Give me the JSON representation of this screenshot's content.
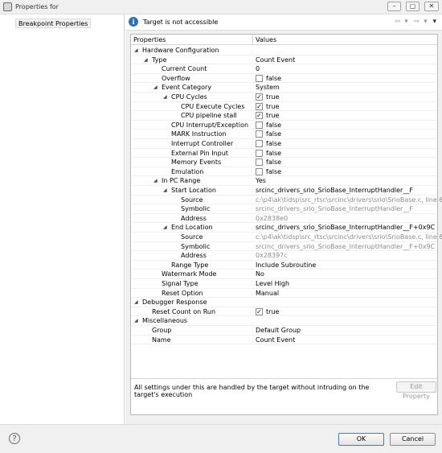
{
  "window": {
    "title": "Properties for",
    "minimize_glyph": "–",
    "maximize_glyph": "▢",
    "close_glyph": "✕"
  },
  "sidebar": {
    "items": [
      {
        "label": "Breakpoint Properties",
        "selected": true
      }
    ]
  },
  "message": {
    "icon": "info-icon",
    "text": "Target is not accessible"
  },
  "history_nav": {
    "back_icon": "back-arrow-icon",
    "forward_icon": "forward-arrow-icon",
    "menu_icon": "menu-triangle-icon"
  },
  "table": {
    "headers": {
      "properties": "Properties",
      "values": "Values"
    },
    "rows": [
      {
        "indent": 1,
        "expander": "expanded",
        "name": "Hardware Configuration",
        "value": "",
        "type": "text"
      },
      {
        "indent": 2,
        "expander": "expanded",
        "name": "Type",
        "value": "Count Event",
        "type": "text"
      },
      {
        "indent": 3,
        "expander": "",
        "name": "Current Count",
        "value": "0",
        "type": "text"
      },
      {
        "indent": 3,
        "expander": "",
        "name": "Overflow",
        "value": "false",
        "type": "checkbox",
        "checked": false
      },
      {
        "indent": 3,
        "expander": "expanded",
        "name": "Event Category",
        "value": "System",
        "type": "text"
      },
      {
        "indent": 4,
        "expander": "expanded",
        "name": "CPU Cycles",
        "value": "true",
        "type": "checkbox",
        "checked": true
      },
      {
        "indent": 5,
        "expander": "",
        "name": "CPU Execute Cycles",
        "value": "true",
        "type": "checkbox",
        "checked": true
      },
      {
        "indent": 5,
        "expander": "",
        "name": "CPU pipeline stall",
        "value": "true",
        "type": "checkbox",
        "checked": true
      },
      {
        "indent": 4,
        "expander": "",
        "name": "CPU Interrupt/Exception",
        "value": "false",
        "type": "checkbox",
        "checked": false
      },
      {
        "indent": 4,
        "expander": "",
        "name": "MARK Instruction",
        "value": "false",
        "type": "checkbox",
        "checked": false
      },
      {
        "indent": 4,
        "expander": "",
        "name": "Interrupt Controller",
        "value": "false",
        "type": "checkbox",
        "checked": false
      },
      {
        "indent": 4,
        "expander": "",
        "name": "External Pin Input",
        "value": "false",
        "type": "checkbox",
        "checked": false
      },
      {
        "indent": 4,
        "expander": "",
        "name": "Memory Events",
        "value": "false",
        "type": "checkbox",
        "checked": false
      },
      {
        "indent": 4,
        "expander": "",
        "name": "Emulation",
        "value": "false",
        "type": "checkbox",
        "checked": false
      },
      {
        "indent": 3,
        "expander": "expanded",
        "name": "In PC Range",
        "value": "Yes",
        "type": "text"
      },
      {
        "indent": 4,
        "expander": "expanded",
        "name": "Start Location",
        "value": "srcinc_drivers_srio_SrioBase_InterruptHandler__F",
        "type": "text"
      },
      {
        "indent": 5,
        "expander": "",
        "name": "Source",
        "value": "c:\\p4\\ak\\tidsp\\src_rtsc\\srcinc\\drivers\\srio\\SrioBase.c, line 688",
        "type": "gray"
      },
      {
        "indent": 5,
        "expander": "",
        "name": "Symbolic",
        "value": "srcinc_drivers_srio_SrioBase_InterruptHandler__F",
        "type": "gray"
      },
      {
        "indent": 5,
        "expander": "",
        "name": "Address",
        "value": "0x2838e0",
        "type": "gray"
      },
      {
        "indent": 4,
        "expander": "expanded",
        "name": "End Location",
        "value": "srcinc_drivers_srio_SrioBase_InterruptHandler__F+0x9C",
        "type": "text"
      },
      {
        "indent": 5,
        "expander": "",
        "name": "Source",
        "value": "c:\\p4\\ak\\tidsp\\src_rtsc\\srcinc\\drivers\\srio\\SrioBase.c, line 693",
        "type": "gray"
      },
      {
        "indent": 5,
        "expander": "",
        "name": "Symbolic",
        "value": "srcinc_drivers_srio_SrioBase_InterruptHandler__F+0x9C",
        "type": "gray"
      },
      {
        "indent": 5,
        "expander": "",
        "name": "Address",
        "value": "0x28397c",
        "type": "gray"
      },
      {
        "indent": 4,
        "expander": "",
        "name": "Range Type",
        "value": "Include Subroutine",
        "type": "text"
      },
      {
        "indent": 3,
        "expander": "",
        "name": "Watermark Mode",
        "value": "No",
        "type": "text"
      },
      {
        "indent": 3,
        "expander": "",
        "name": "Signal Type",
        "value": "Level High",
        "type": "text"
      },
      {
        "indent": 3,
        "expander": "",
        "name": "Reset Option",
        "value": "Manual",
        "type": "text"
      },
      {
        "indent": 1,
        "expander": "expanded",
        "name": "Debugger Response",
        "value": "",
        "type": "text"
      },
      {
        "indent": 2,
        "expander": "",
        "name": "Reset Count on Run",
        "value": "true",
        "type": "checkbox",
        "checked": true
      },
      {
        "indent": 1,
        "expander": "expanded",
        "name": "Miscellaneous",
        "value": "",
        "type": "text"
      },
      {
        "indent": 2,
        "expander": "",
        "name": "Group",
        "value": "Default Group",
        "type": "text"
      },
      {
        "indent": 2,
        "expander": "",
        "name": "Name",
        "value": "Count Event",
        "type": "text"
      }
    ]
  },
  "footer": {
    "note": "All settings under this are handled by the target without intruding on the target's execution",
    "edit_property_label": "Edit Property"
  },
  "buttons": {
    "ok_label": "OK",
    "cancel_label": "Cancel",
    "help_icon": "help-icon"
  }
}
